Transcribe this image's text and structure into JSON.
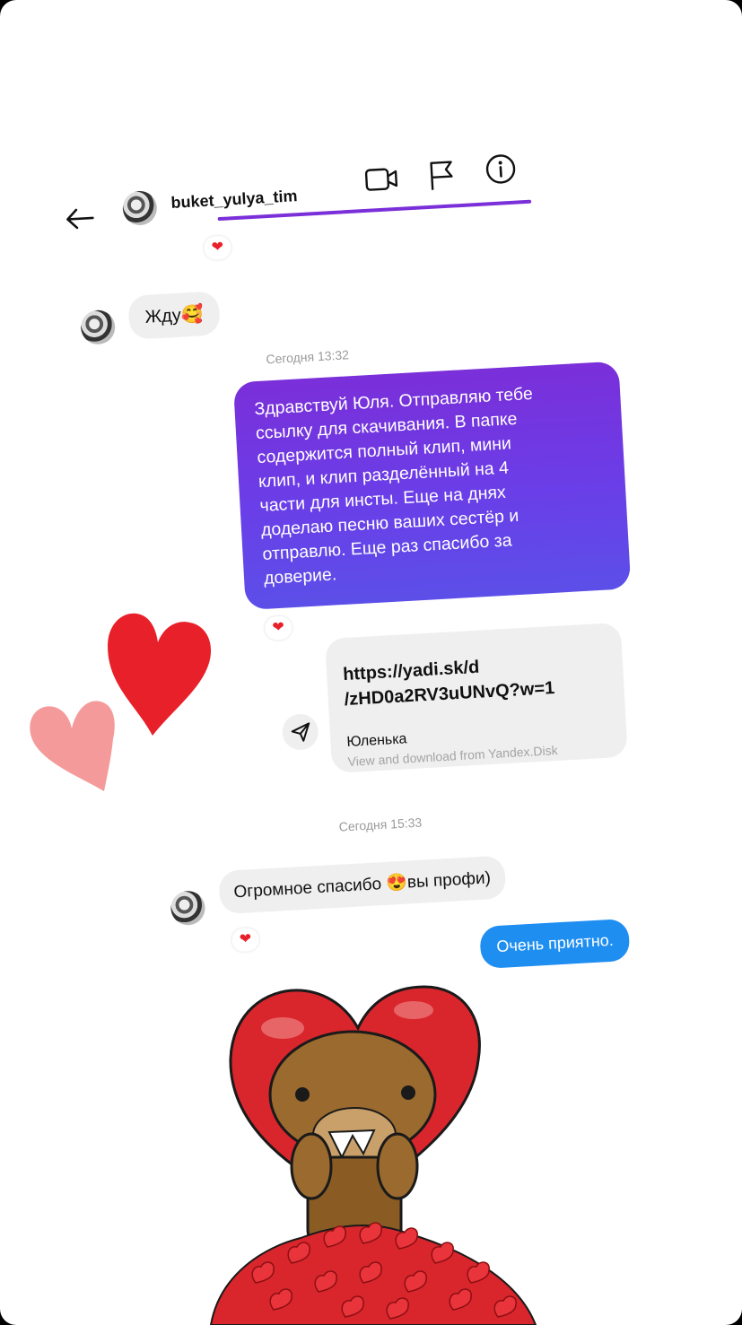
{
  "header": {
    "username": "buket_yulya_tim"
  },
  "messages": {
    "m1_text": "Жду",
    "m1_emoji": "🥰",
    "ts1": "Сегодня 13:32",
    "m2_lines": [
      "Здравствуй Юля. Отправляю тебе",
      "ссылку для скачивания. В папке",
      "содержится полный клип, мини",
      "клип, и клип разделённый на 4",
      "части для  инсты. Еще на днях",
      "доделаю песню ваших сестёр и",
      "отправлю. Еще раз спасибо за",
      "доверие."
    ],
    "link_line1": "https://yadi.sk/d",
    "link_line2": "/zHD0a2RV3uUNvQ?w=1",
    "link_title": "Юленька",
    "link_sub": "View and download from Yandex.Disk",
    "ts2": "Сегодня 15:33",
    "m3_text_a": "Огромное спасибо ",
    "m3_emoji": "😍",
    "m3_text_b": "вы профи)",
    "m4_text": "Очень приятно.",
    "reaction": "❤"
  },
  "colors": {
    "accent_purple": "#7a2fd9",
    "bubble_blue": "#1f8ef1",
    "heart_red": "#e8202a",
    "heart_pink": "#f59a9a"
  },
  "icons": {
    "back": "arrow-left-icon",
    "video": "video-camera-icon",
    "flag": "flag-icon",
    "info": "info-icon",
    "share": "send-icon"
  }
}
